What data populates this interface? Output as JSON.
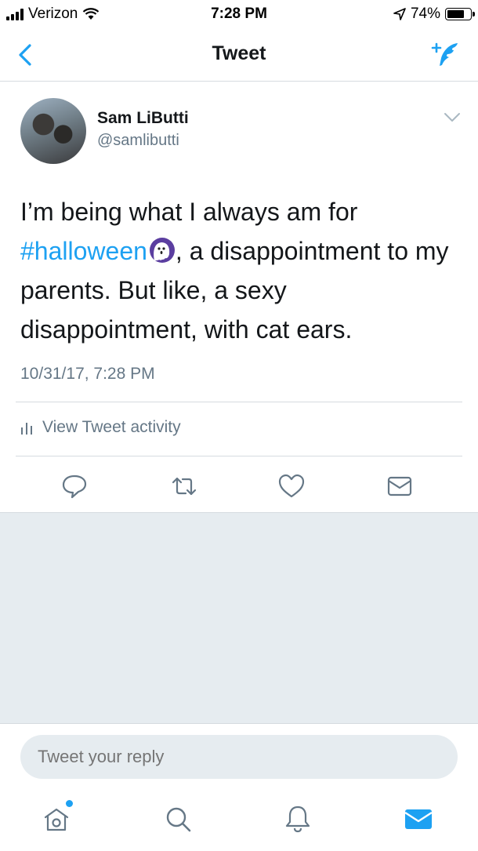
{
  "status_bar": {
    "carrier": "Verizon",
    "time": "7:28 PM",
    "battery": "74%",
    "battery_level": 0.74,
    "icons": [
      "signal-icon",
      "wifi-icon",
      "location-arrow-icon",
      "battery-icon"
    ]
  },
  "nav": {
    "title": "Tweet",
    "back_icon": "chevron-left-icon",
    "compose_icon": "compose-tweet-icon"
  },
  "tweet": {
    "author_name": "Sam LiButti",
    "author_handle": "@samlibutti",
    "text_before": "I’m being what I always am for ",
    "hashtag": "#halloween",
    "text_after": ", a disappointment to my parents. But like, a sexy disappointment, with cat ears.",
    "emoji": "ghost-emoji",
    "timestamp": "10/31/17, 7:28 PM",
    "activity_label": "View Tweet activity",
    "actions": [
      "reply-icon",
      "retweet-icon",
      "like-icon",
      "direct-message-icon"
    ]
  },
  "reply": {
    "placeholder": "Tweet your reply"
  },
  "tab_bar": {
    "tabs": [
      "home-icon",
      "search-icon",
      "notifications-icon",
      "messages-icon"
    ],
    "active": "messages-icon"
  },
  "colors": {
    "accent": "#1da1f2",
    "secondary_text": "#657786",
    "gray_background": "#e6ecf0",
    "divider": "#d6dbe0"
  }
}
